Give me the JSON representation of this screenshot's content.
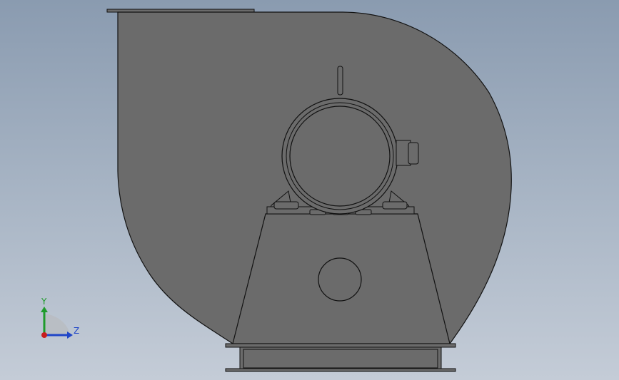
{
  "viewport": {
    "background_top": "#8a9bb0",
    "background_bottom": "#c4ccd7"
  },
  "model": {
    "body_color": "#6b6b6b",
    "edge_color": "#111111"
  },
  "triad": {
    "y_label": "Y",
    "z_label": "Z",
    "y_color": "#1f9b2b",
    "z_color": "#2046c8",
    "x_color": "#c81e1e"
  }
}
